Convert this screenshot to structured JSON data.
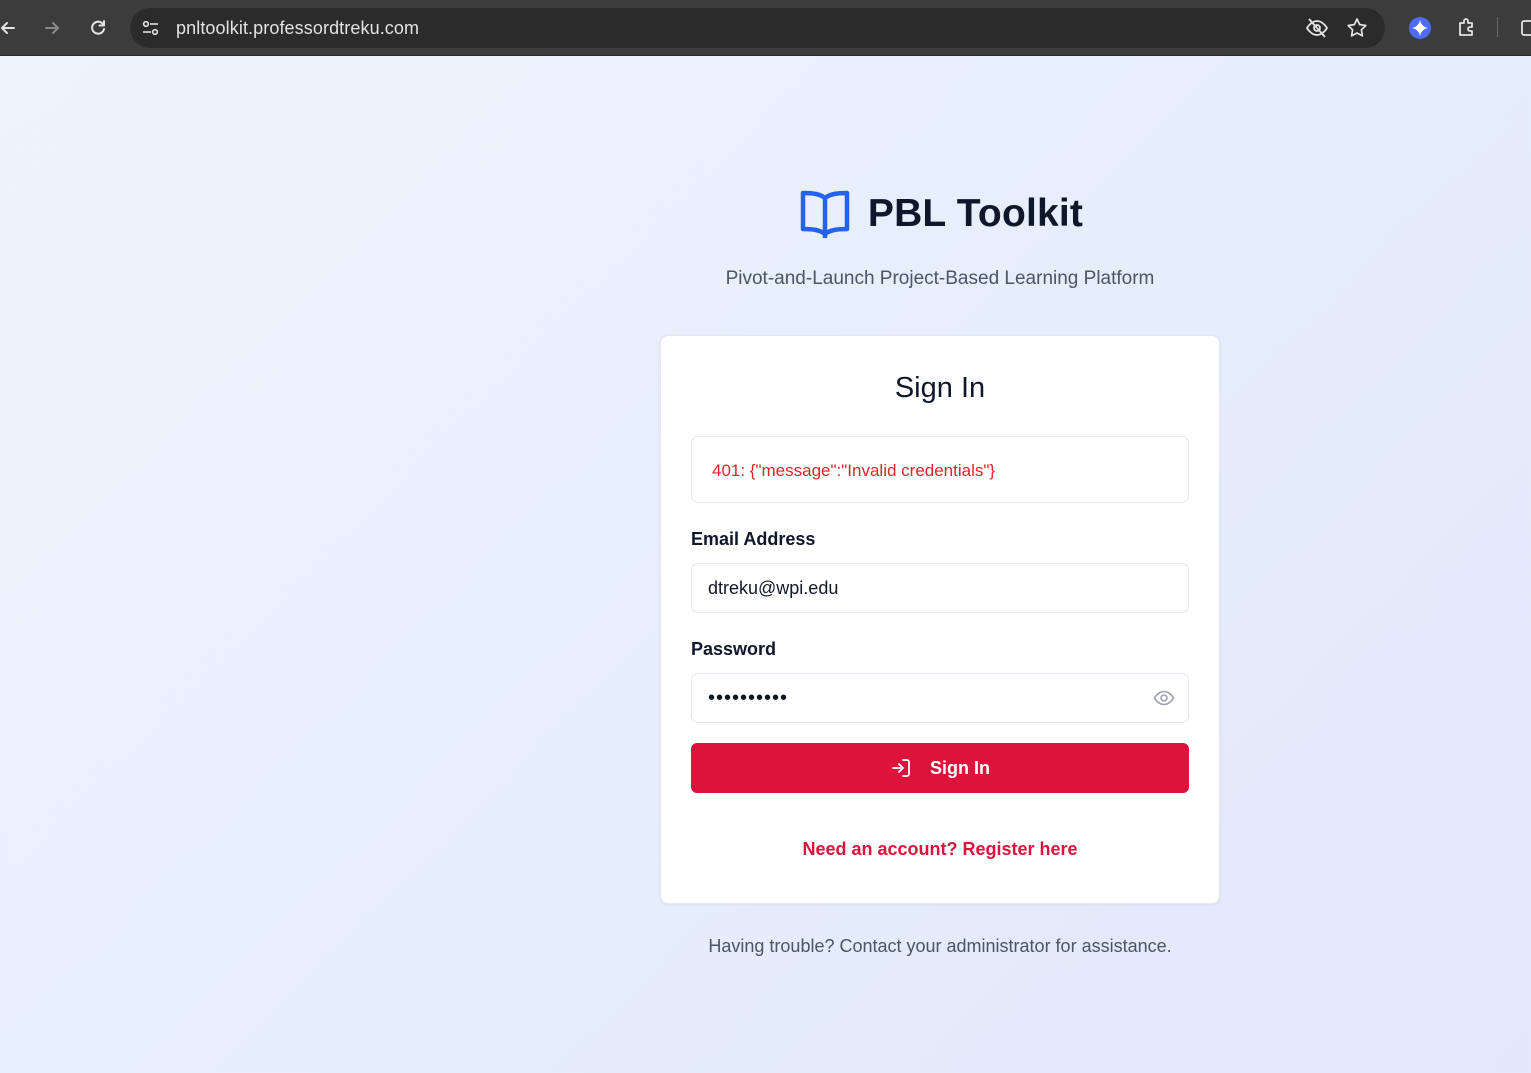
{
  "browser": {
    "url": "pnltoolkit.professordtreku.com"
  },
  "brand": {
    "title": "PBL Toolkit",
    "tagline": "Pivot-and-Launch Project-Based Learning Platform",
    "logo_icon": "book-open-icon",
    "accent_color": "#2563eb"
  },
  "form": {
    "title": "Sign In",
    "error": "401: {\"message\":\"Invalid credentials\"}",
    "email_label": "Email Address",
    "email_value": "dtreku@wpi.edu",
    "password_label": "Password",
    "password_value": "••••••••••",
    "submit_label": "Sign In",
    "submit_color": "#dc143c",
    "register_link": "Need an account? Register here"
  },
  "footer": {
    "help_text": "Having trouble? Contact your administrator for assistance."
  }
}
